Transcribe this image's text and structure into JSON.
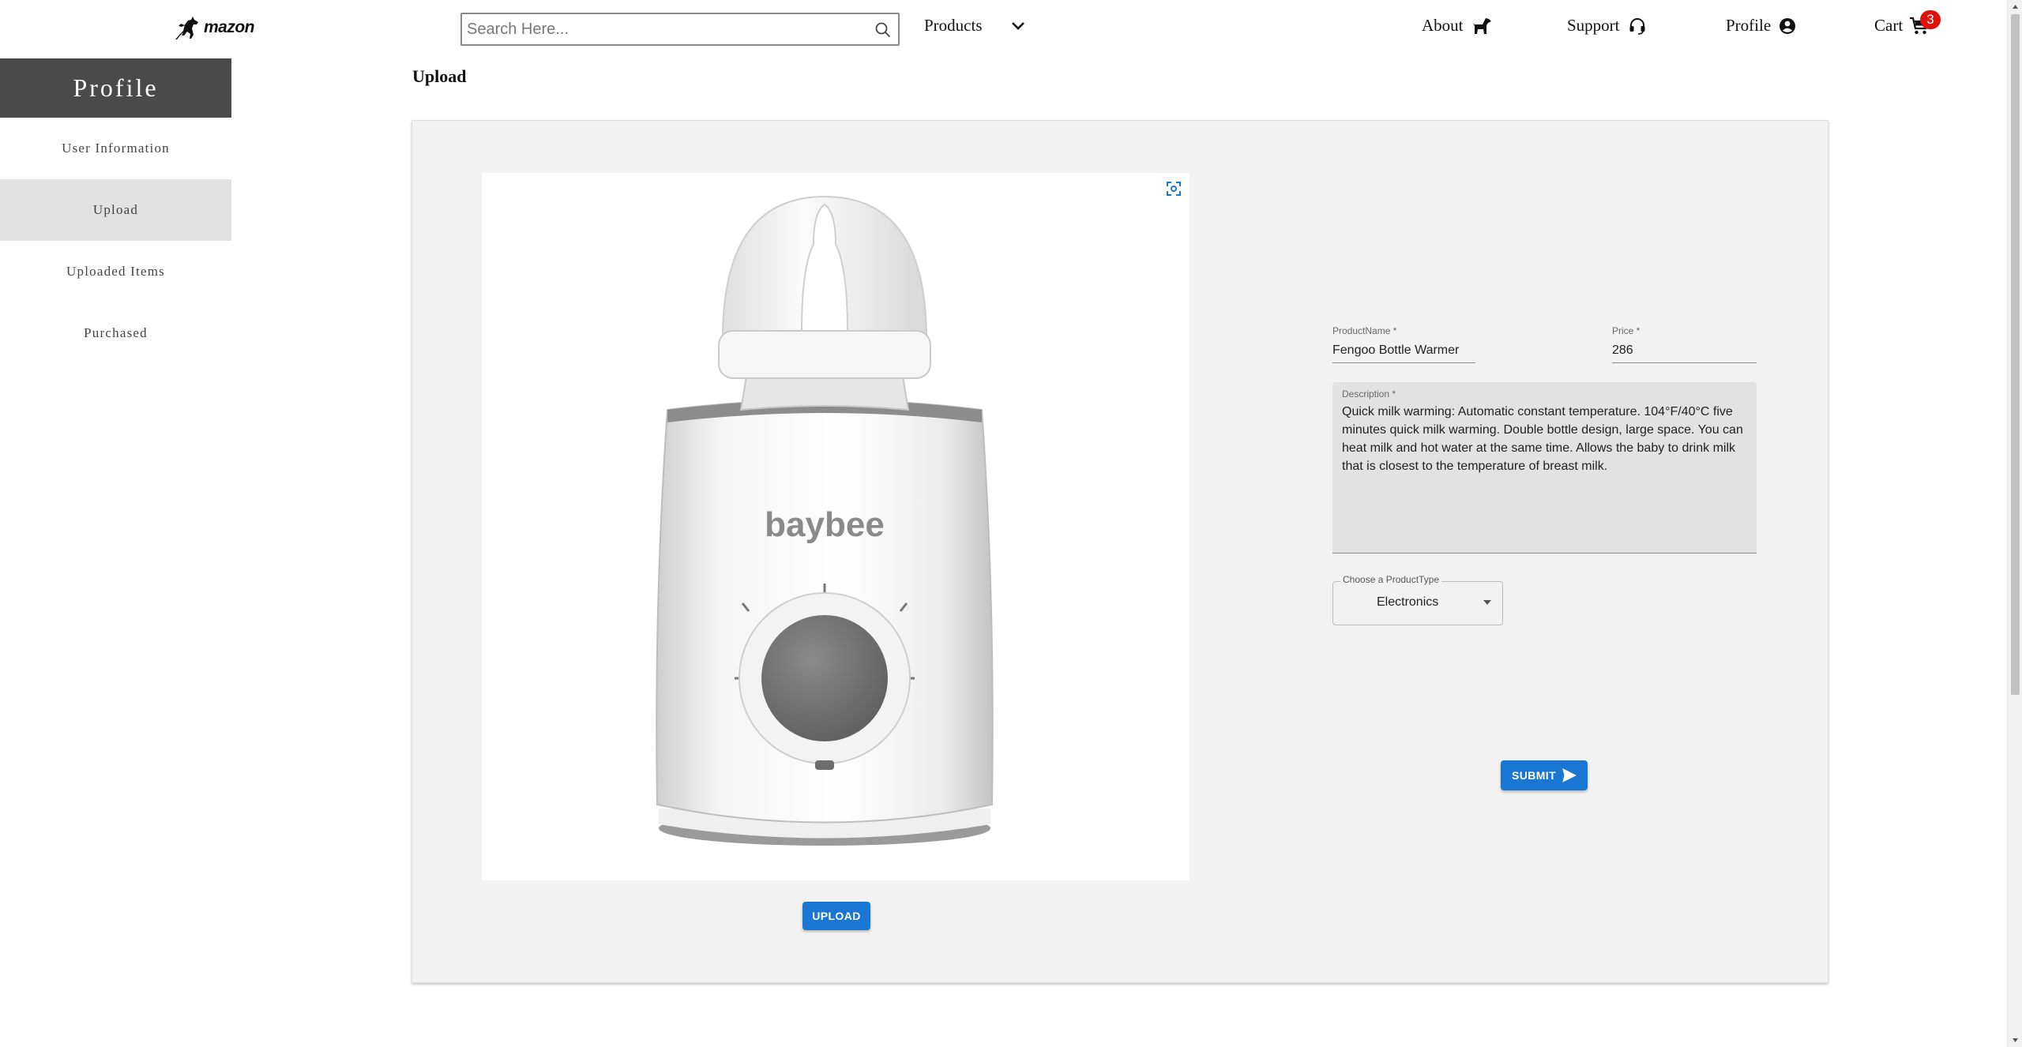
{
  "brand": {
    "logo_text": "mazon"
  },
  "search": {
    "placeholder": "Search Here..."
  },
  "nav": {
    "products": "Products",
    "about": "About",
    "support": "Support",
    "profile": "Profile",
    "cart": "Cart",
    "cart_count": "3"
  },
  "sidebar": {
    "title": "Profile",
    "items": [
      {
        "label": "User Information"
      },
      {
        "label": "Upload"
      },
      {
        "label": "Uploaded Items"
      },
      {
        "label": "Purchased"
      }
    ]
  },
  "main": {
    "title": "Upload",
    "image": {
      "brand_print": "baybee"
    },
    "upload_button": "UPLOAD",
    "form": {
      "product_name_label": "ProductName *",
      "product_name_value": "Fengoo Bottle Warmer",
      "price_label": "Price *",
      "price_value": "286",
      "description_label": "Description *",
      "description_value": "Quick milk warming: Automatic constant temperature. 104°F/40°C five minutes quick milk warming. Double bottle design, large space. You can heat milk and hot water at the same time. Allows the baby to drink milk that is closest to the temperature of breast milk.",
      "product_type_label": "Choose a ProductType",
      "product_type_value": "Electronics",
      "submit_button": "SUBMIT"
    }
  },
  "colors": {
    "accent": "#1976d2",
    "sidebar_header": "#4a4a4a",
    "cart_badge": "#e0120e",
    "card_background": "#f2f2f2"
  },
  "icons": {
    "logo": "dog-logo-icon",
    "search": "search-icon",
    "products_dropdown": "chevron-down-icon",
    "about": "dog-icon",
    "support": "headset-icon",
    "profile": "account-circle-icon",
    "cart": "shopping-cart-icon",
    "image_expand": "fullscreen-icon",
    "submit": "send-icon",
    "select": "arrow-drop-down-icon"
  }
}
